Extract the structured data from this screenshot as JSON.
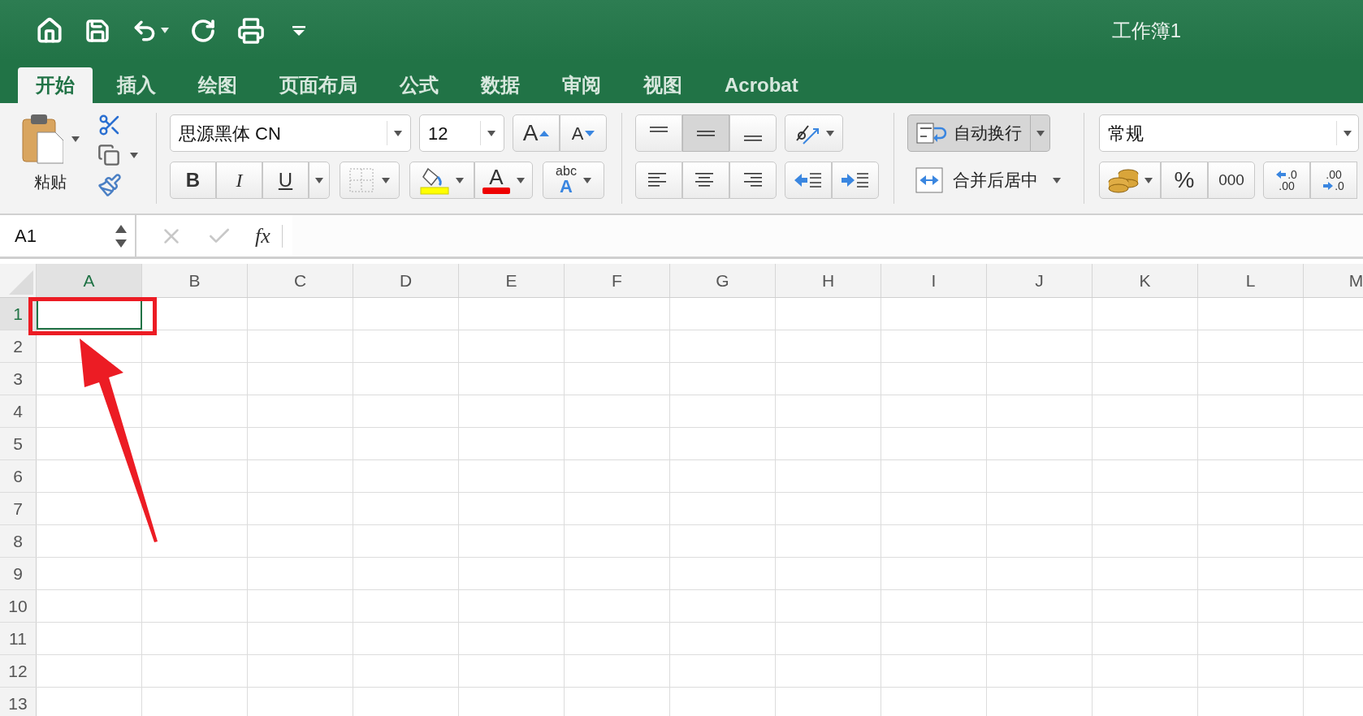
{
  "title": "工作簿1",
  "tabs": [
    {
      "label": "开始",
      "selected": true
    },
    {
      "label": "插入",
      "selected": false
    },
    {
      "label": "绘图",
      "selected": false
    },
    {
      "label": "页面布局",
      "selected": false
    },
    {
      "label": "公式",
      "selected": false
    },
    {
      "label": "数据",
      "selected": false
    },
    {
      "label": "审阅",
      "selected": false
    },
    {
      "label": "视图",
      "selected": false
    },
    {
      "label": "Acrobat",
      "selected": false
    }
  ],
  "ribbon": {
    "paste_label": "粘贴",
    "font_name": "思源黑体 CN",
    "font_size": "12",
    "grow_font": "A",
    "shrink_font": "A",
    "bold": "B",
    "italic": "I",
    "underline": "U",
    "font_color": "A",
    "abc_top": "abc",
    "abc_bottom": "A",
    "vertical_align": [
      {
        "selected": false
      },
      {
        "selected": true
      },
      {
        "selected": false
      }
    ],
    "wrap": {
      "label": "自动换行",
      "selected": true
    },
    "merge": "合并后居中",
    "number_format": "常规",
    "percent": "%",
    "thousands": "000",
    "increase_decimal": [
      ".0",
      ".00"
    ],
    "decrease_decimal": [
      ".00",
      ".0"
    ]
  },
  "formula_bar": {
    "name_box": "A1",
    "fx": "fx"
  },
  "grid": {
    "columns": [
      {
        "label": "A",
        "selected": true
      },
      {
        "label": "B",
        "selected": false
      },
      {
        "label": "C",
        "selected": false
      },
      {
        "label": "D",
        "selected": false
      },
      {
        "label": "E",
        "selected": false
      },
      {
        "label": "F",
        "selected": false
      },
      {
        "label": "G",
        "selected": false
      },
      {
        "label": "H",
        "selected": false
      },
      {
        "label": "I",
        "selected": false
      },
      {
        "label": "J",
        "selected": false
      },
      {
        "label": "K",
        "selected": false
      },
      {
        "label": "L",
        "selected": false
      },
      {
        "label": "M",
        "selected": false
      }
    ],
    "rows": [
      {
        "label": "1",
        "selected": true
      },
      {
        "label": "2",
        "selected": false
      },
      {
        "label": "3",
        "selected": false
      },
      {
        "label": "4",
        "selected": false
      },
      {
        "label": "5",
        "selected": false
      },
      {
        "label": "6",
        "selected": false
      },
      {
        "label": "7",
        "selected": false
      },
      {
        "label": "8",
        "selected": false
      },
      {
        "label": "9",
        "selected": false
      },
      {
        "label": "10",
        "selected": false
      },
      {
        "label": "11",
        "selected": false
      },
      {
        "label": "12",
        "selected": false
      },
      {
        "label": "13",
        "selected": false
      }
    ]
  }
}
